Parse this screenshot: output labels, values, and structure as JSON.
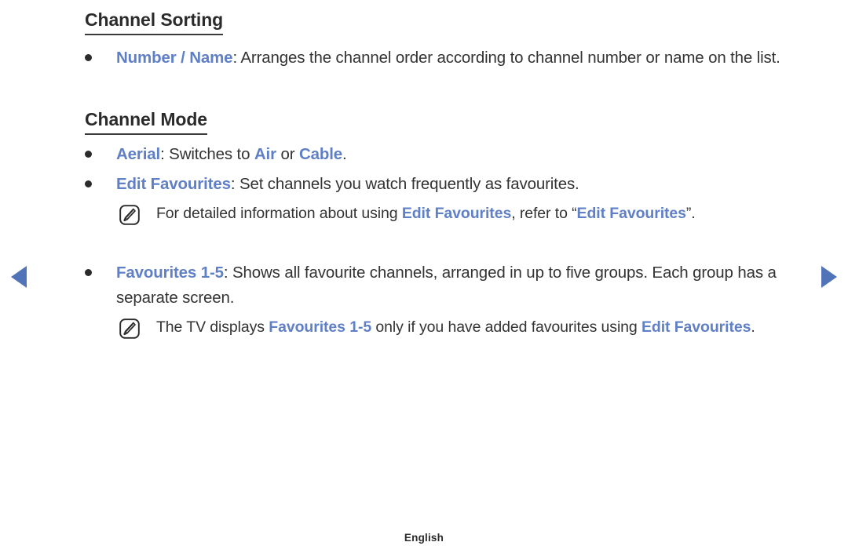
{
  "accent_color": "#5f7fc6",
  "text_color": "#333333",
  "arrow_color": "#5173b8",
  "nav": {
    "prev_label": "◀",
    "next_label": "▶"
  },
  "sections": [
    {
      "heading": "Channel Sorting",
      "bullets": [
        {
          "term": "Number / Name",
          "separator": ": ",
          "text": "Arranges the channel order according to channel number or name on the list."
        }
      ]
    },
    {
      "heading": "Channel Mode",
      "bullets": [
        {
          "term": "Aerial",
          "separator": ": ",
          "text_a": "Switches to ",
          "inline_1": "Air",
          "text_b": " or ",
          "inline_2": "Cable",
          "text_c": "."
        },
        {
          "term": "Edit Favourites",
          "separator": ": ",
          "text": "Set channels you watch frequently as favourites."
        },
        {
          "term": "Favourites 1-5",
          "separator": ": ",
          "text": "Shows all favourite channels, arranged in up to five groups. Each group has a separate screen."
        }
      ]
    }
  ],
  "notes": [
    {
      "icon": "note-pencil-icon",
      "text_a": "For detailed information about using ",
      "inline_1": "Edit Favourites",
      "text_b": ", refer to “",
      "inline_2": "Edit Favourites",
      "text_c": "”."
    },
    {
      "icon": "note-pencil-icon",
      "text_a": "The TV displays ",
      "inline_1": "Favourites 1-5",
      "text_b": " only if you have added favourites using ",
      "inline_2": "Edit Favourites",
      "text_c": "."
    }
  ],
  "footer": {
    "language": "English"
  }
}
